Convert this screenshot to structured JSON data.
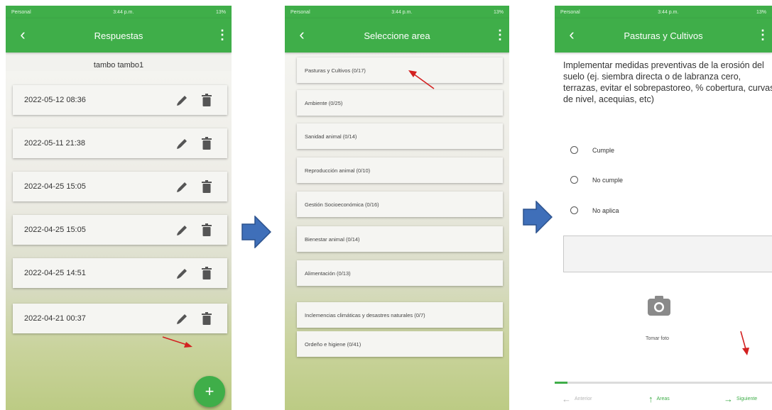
{
  "colors": {
    "app_green": "#3fae49",
    "red_arrow": "#d32020",
    "blue_arrow": "#3f6fb9"
  },
  "status_bar": {
    "carrier": "Personal",
    "time": "3:44 p.m.",
    "battery": "13%"
  },
  "screen1": {
    "title": "Respuestas",
    "subtitle": "tambo tambo1",
    "answers": [
      {
        "date": "2022-05-12 08:36"
      },
      {
        "date": "2022-05-11 21:38"
      },
      {
        "date": "2022-04-25 15:05"
      },
      {
        "date": "2022-04-25 15:05"
      },
      {
        "date": "2022-04-25 14:51"
      },
      {
        "date": "2022-04-21 00:37"
      }
    ],
    "fab_label": "+"
  },
  "screen2": {
    "title": "Seleccione area",
    "areas": [
      "Pasturas y Cultivos (0/17)",
      "Ambiente (0/25)",
      "Sanidad animal (0/14)",
      "Reproducción animal (0/10)",
      "Gestión Socioeconómica (0/16)",
      "Bienestar animal (0/14)",
      "Alimentación (0/13)",
      "Inclemencias climáticas y desastres naturales (0/7)",
      "Ordeño e higiene (0/41)"
    ]
  },
  "screen3": {
    "title": "Pasturas y Cultivos",
    "question": "Implementar medidas preventivas de la erosión del suelo (ej. siembra directa o de labranza cero, terrazas, evitar el sobrepastoreo, % cobertura, curvas de nivel, acequias, etc)",
    "options": [
      "Cumple",
      "No cumple",
      "No aplica"
    ],
    "comment_value": "",
    "photo_label": "Tomar foto",
    "progress_fraction": 0.06,
    "nav": {
      "previous": "Anterior",
      "areas": "Areas",
      "next": "Siguiente"
    }
  }
}
